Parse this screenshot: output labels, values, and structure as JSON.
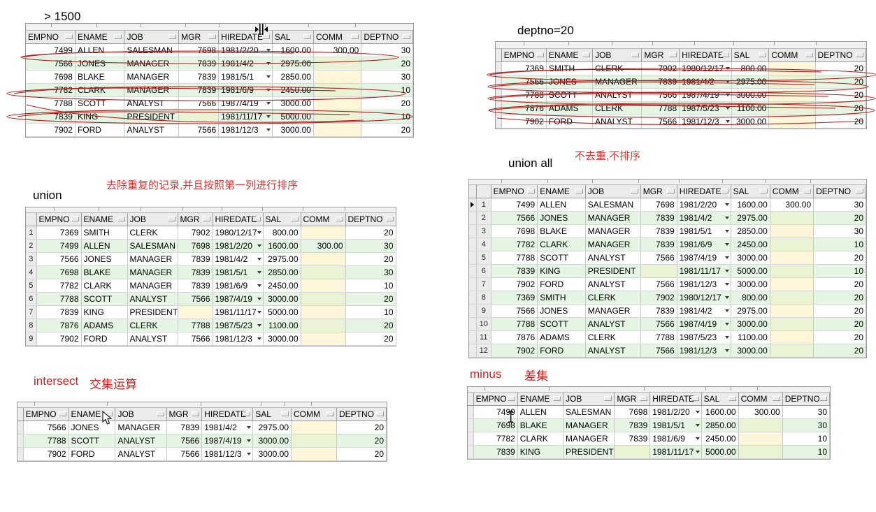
{
  "columns": [
    "EMPNO",
    "ENAME",
    "JOB",
    "MGR",
    "HIREDATE",
    "SAL",
    "COMM",
    "DEPTNO"
  ],
  "sections": {
    "gt1500": {
      "title": "> 1500",
      "rows": [
        {
          "empno": "7499",
          "ename": "ALLEN",
          "job": "SALESMAN",
          "mgr": "7698",
          "hiredate": "1981/2/20",
          "sal": "1600.00",
          "comm": "300.00",
          "deptno": "30"
        },
        {
          "empno": "7566",
          "ename": "JONES",
          "job": "MANAGER",
          "mgr": "7839",
          "hiredate": "1981/4/2",
          "sal": "2975.00",
          "comm": "",
          "deptno": "20"
        },
        {
          "empno": "7698",
          "ename": "BLAKE",
          "job": "MANAGER",
          "mgr": "7839",
          "hiredate": "1981/5/1",
          "sal": "2850.00",
          "comm": "",
          "deptno": "30"
        },
        {
          "empno": "7782",
          "ename": "CLARK",
          "job": "MANAGER",
          "mgr": "7839",
          "hiredate": "1981/6/9",
          "sal": "2450.00",
          "comm": "",
          "deptno": "10"
        },
        {
          "empno": "7788",
          "ename": "SCOTT",
          "job": "ANALYST",
          "mgr": "7566",
          "hiredate": "1987/4/19",
          "sal": "3000.00",
          "comm": "",
          "deptno": "20"
        },
        {
          "empno": "7839",
          "ename": "KING",
          "job": "PRESIDENT",
          "mgr": "",
          "hiredate": "1981/11/17",
          "sal": "5000.00",
          "comm": "",
          "deptno": "10"
        },
        {
          "empno": "7902",
          "ename": "FORD",
          "job": "ANALYST",
          "mgr": "7566",
          "hiredate": "1981/12/3",
          "sal": "3000.00",
          "comm": "",
          "deptno": "20"
        }
      ]
    },
    "deptno20": {
      "title": "deptno=20",
      "rows": [
        {
          "empno": "7369",
          "ename": "SMITH",
          "job": "CLERK",
          "mgr": "7902",
          "hiredate": "1980/12/17",
          "sal": "800.00",
          "comm": "",
          "deptno": "20"
        },
        {
          "empno": "7566",
          "ename": "JONES",
          "job": "MANAGER",
          "mgr": "7839",
          "hiredate": "1981/4/2",
          "sal": "2975.00",
          "comm": "",
          "deptno": "20"
        },
        {
          "empno": "7788",
          "ename": "SCOTT",
          "job": "ANALYST",
          "mgr": "7566",
          "hiredate": "1987/4/19",
          "sal": "3000.00",
          "comm": "",
          "deptno": "20"
        },
        {
          "empno": "7876",
          "ename": "ADAMS",
          "job": "CLERK",
          "mgr": "7788",
          "hiredate": "1987/5/23",
          "sal": "1100.00",
          "comm": "",
          "deptno": "20"
        },
        {
          "empno": "7902",
          "ename": "FORD",
          "job": "ANALYST",
          "mgr": "7566",
          "hiredate": "1981/12/3",
          "sal": "3000.00",
          "comm": "",
          "deptno": "20"
        }
      ]
    },
    "union": {
      "title": "union",
      "annotation": "去除重复的记录,并且按照第一列进行排序",
      "rows": [
        {
          "no": "1",
          "empno": "7369",
          "ename": "SMITH",
          "job": "CLERK",
          "mgr": "7902",
          "hiredate": "1980/12/17",
          "sal": "800.00",
          "comm": "",
          "deptno": "20"
        },
        {
          "no": "2",
          "empno": "7499",
          "ename": "ALLEN",
          "job": "SALESMAN",
          "mgr": "7698",
          "hiredate": "1981/2/20",
          "sal": "1600.00",
          "comm": "300.00",
          "deptno": "30"
        },
        {
          "no": "3",
          "empno": "7566",
          "ename": "JONES",
          "job": "MANAGER",
          "mgr": "7839",
          "hiredate": "1981/4/2",
          "sal": "2975.00",
          "comm": "",
          "deptno": "20"
        },
        {
          "no": "4",
          "empno": "7698",
          "ename": "BLAKE",
          "job": "MANAGER",
          "mgr": "7839",
          "hiredate": "1981/5/1",
          "sal": "2850.00",
          "comm": "",
          "deptno": "30"
        },
        {
          "no": "5",
          "empno": "7782",
          "ename": "CLARK",
          "job": "MANAGER",
          "mgr": "7839",
          "hiredate": "1981/6/9",
          "sal": "2450.00",
          "comm": "",
          "deptno": "10"
        },
        {
          "no": "6",
          "empno": "7788",
          "ename": "SCOTT",
          "job": "ANALYST",
          "mgr": "7566",
          "hiredate": "1987/4/19",
          "sal": "3000.00",
          "comm": "",
          "deptno": "20"
        },
        {
          "no": "7",
          "empno": "7839",
          "ename": "KING",
          "job": "PRESIDENT",
          "mgr": "",
          "hiredate": "1981/11/17",
          "sal": "5000.00",
          "comm": "",
          "deptno": "10"
        },
        {
          "no": "8",
          "empno": "7876",
          "ename": "ADAMS",
          "job": "CLERK",
          "mgr": "7788",
          "hiredate": "1987/5/23",
          "sal": "1100.00",
          "comm": "",
          "deptno": "20"
        },
        {
          "no": "9",
          "empno": "7902",
          "ename": "FORD",
          "job": "ANALYST",
          "mgr": "7566",
          "hiredate": "1981/12/3",
          "sal": "3000.00",
          "comm": "",
          "deptno": "20"
        }
      ]
    },
    "union_all": {
      "title": "union all",
      "annotation": "不去重,不排序",
      "rows": [
        {
          "no": "1",
          "empno": "7499",
          "ename": "ALLEN",
          "job": "SALESMAN",
          "mgr": "7698",
          "hiredate": "1981/2/20",
          "sal": "1600.00",
          "comm": "300.00",
          "deptno": "30"
        },
        {
          "no": "2",
          "empno": "7566",
          "ename": "JONES",
          "job": "MANAGER",
          "mgr": "7839",
          "hiredate": "1981/4/2",
          "sal": "2975.00",
          "comm": "",
          "deptno": "20"
        },
        {
          "no": "3",
          "empno": "7698",
          "ename": "BLAKE",
          "job": "MANAGER",
          "mgr": "7839",
          "hiredate": "1981/5/1",
          "sal": "2850.00",
          "comm": "",
          "deptno": "30"
        },
        {
          "no": "4",
          "empno": "7782",
          "ename": "CLARK",
          "job": "MANAGER",
          "mgr": "7839",
          "hiredate": "1981/6/9",
          "sal": "2450.00",
          "comm": "",
          "deptno": "10"
        },
        {
          "no": "5",
          "empno": "7788",
          "ename": "SCOTT",
          "job": "ANALYST",
          "mgr": "7566",
          "hiredate": "1987/4/19",
          "sal": "3000.00",
          "comm": "",
          "deptno": "20"
        },
        {
          "no": "6",
          "empno": "7839",
          "ename": "KING",
          "job": "PRESIDENT",
          "mgr": "",
          "hiredate": "1981/11/17",
          "sal": "5000.00",
          "comm": "",
          "deptno": "10"
        },
        {
          "no": "7",
          "empno": "7902",
          "ename": "FORD",
          "job": "ANALYST",
          "mgr": "7566",
          "hiredate": "1981/12/3",
          "sal": "3000.00",
          "comm": "",
          "deptno": "20"
        },
        {
          "no": "8",
          "empno": "7369",
          "ename": "SMITH",
          "job": "CLERK",
          "mgr": "7902",
          "hiredate": "1980/12/17",
          "sal": "800.00",
          "comm": "",
          "deptno": "20"
        },
        {
          "no": "9",
          "empno": "7566",
          "ename": "JONES",
          "job": "MANAGER",
          "mgr": "7839",
          "hiredate": "1981/4/2",
          "sal": "2975.00",
          "comm": "",
          "deptno": "20"
        },
        {
          "no": "10",
          "empno": "7788",
          "ename": "SCOTT",
          "job": "ANALYST",
          "mgr": "7566",
          "hiredate": "1987/4/19",
          "sal": "3000.00",
          "comm": "",
          "deptno": "20"
        },
        {
          "no": "11",
          "empno": "7876",
          "ename": "ADAMS",
          "job": "CLERK",
          "mgr": "7788",
          "hiredate": "1987/5/23",
          "sal": "1100.00",
          "comm": "",
          "deptno": "20"
        },
        {
          "no": "12",
          "empno": "7902",
          "ename": "FORD",
          "job": "ANALYST",
          "mgr": "7566",
          "hiredate": "1981/12/3",
          "sal": "3000.00",
          "comm": "",
          "deptno": "20"
        }
      ]
    },
    "intersect": {
      "title": "intersect",
      "annotation": "交集运算",
      "rows": [
        {
          "empno": "7566",
          "ename": "JONES",
          "job": "MANAGER",
          "mgr": "7839",
          "hiredate": "1981/4/2",
          "sal": "2975.00",
          "comm": "",
          "deptno": "20"
        },
        {
          "empno": "7788",
          "ename": "SCOTT",
          "job": "ANALYST",
          "mgr": "7566",
          "hiredate": "1987/4/19",
          "sal": "3000.00",
          "comm": "",
          "deptno": "20"
        },
        {
          "empno": "7902",
          "ename": "FORD",
          "job": "ANALYST",
          "mgr": "7566",
          "hiredate": "1981/12/3",
          "sal": "3000.00",
          "comm": "",
          "deptno": "20"
        }
      ]
    },
    "minus": {
      "title": "minus",
      "annotation": "差集",
      "rows": [
        {
          "empno": "7499",
          "ename": "ALLEN",
          "job": "SALESMAN",
          "mgr": "7698",
          "hiredate": "1981/2/20",
          "sal": "1600.00",
          "comm": "300.00",
          "deptno": "30"
        },
        {
          "empno": "7698",
          "ename": "BLAKE",
          "job": "MANAGER",
          "mgr": "7839",
          "hiredate": "1981/5/1",
          "sal": "2850.00",
          "comm": "",
          "deptno": "30"
        },
        {
          "empno": "7782",
          "ename": "CLARK",
          "job": "MANAGER",
          "mgr": "7839",
          "hiredate": "1981/6/9",
          "sal": "2450.00",
          "comm": "",
          "deptno": "10"
        },
        {
          "empno": "7839",
          "ename": "KING",
          "job": "PRESIDENT",
          "mgr": "",
          "hiredate": "1981/11/17",
          "sal": "5000.00",
          "comm": "",
          "deptno": "10"
        }
      ]
    }
  },
  "colors": {
    "annotation_red": "#e03535",
    "title_red": "#d01f1f",
    "row_alt_green": "#e5f5e3",
    "null_yellow": "#fdf6d8",
    "header_gray": "#ebebeb",
    "overlay_red": "#b02020"
  },
  "cursors": {
    "col_resize": "column-resize-cursor",
    "arrow": "arrow-cursor",
    "ibeam": "ibeam-cursor"
  }
}
